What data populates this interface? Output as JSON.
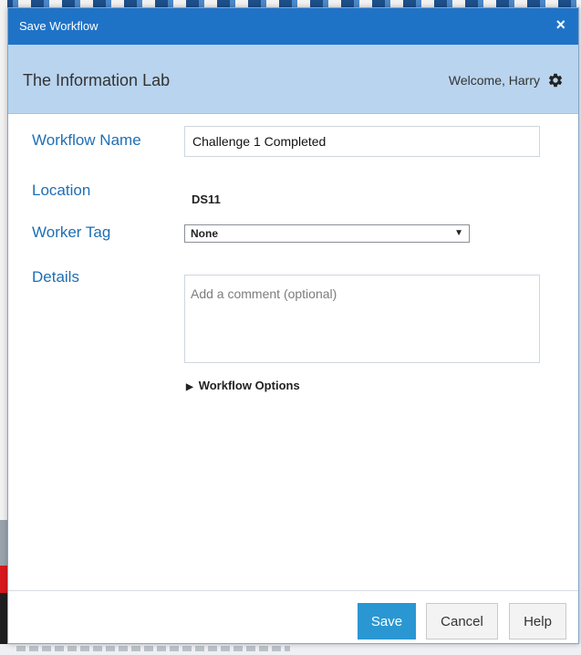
{
  "dialog": {
    "title": "Save Workflow",
    "close_label": "×"
  },
  "header": {
    "org_name": "The Information Lab",
    "welcome_prefix": "Welcome,",
    "user_name": "Harry",
    "settings_icon": "gear-icon"
  },
  "form": {
    "workflow_name_label": "Workflow Name",
    "workflow_name_value": "Challenge 1 Completed",
    "location_label": "Location",
    "location_value": "DS11",
    "worker_tag_label": "Worker Tag",
    "worker_tag_value": "None",
    "details_label": "Details",
    "details_placeholder": "Add a comment (optional)",
    "workflow_options_label": "Workflow Options"
  },
  "footer": {
    "save_label": "Save",
    "cancel_label": "Cancel",
    "help_label": "Help"
  },
  "colors": {
    "titlebar": "#1f73c7",
    "header": "#b9d4ee",
    "label_blue": "#1e6fb5",
    "save_button": "#2a97d2"
  }
}
